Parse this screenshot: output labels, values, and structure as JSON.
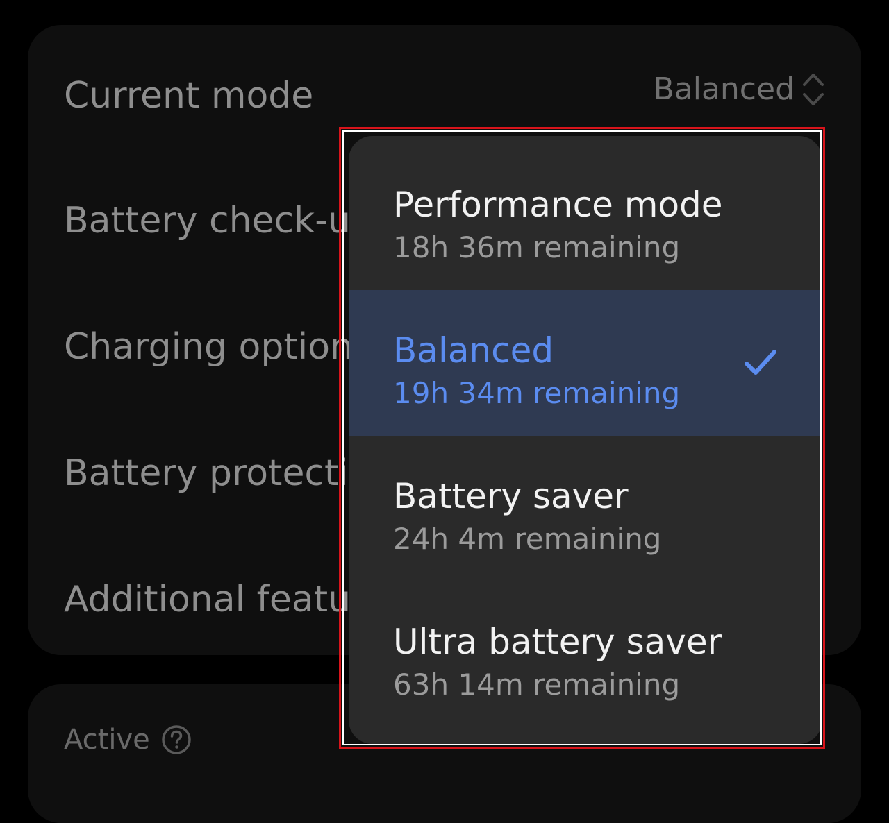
{
  "settings": {
    "current_mode_label": "Current mode",
    "current_mode_value": "Balanced",
    "rows": [
      {
        "label": "Battery check-up"
      },
      {
        "label": "Charging options"
      },
      {
        "label": "Battery protection"
      },
      {
        "label": "Additional features"
      }
    ],
    "active_label": "Active"
  },
  "menu": {
    "items": [
      {
        "title": "Performance mode",
        "subtitle": "18h 36m remaining",
        "selected": false
      },
      {
        "title": "Balanced",
        "subtitle": "19h 34m remaining",
        "selected": true
      },
      {
        "title": "Battery saver",
        "subtitle": "24h 4m remaining",
        "selected": false
      },
      {
        "title": "Ultra battery saver",
        "subtitle": "63h 14m remaining",
        "selected": false
      }
    ]
  },
  "icons": {
    "mode_toggle": "chevron-up-down-icon",
    "active_help": "help-circle-icon",
    "selected_check": "checkmark-icon"
  },
  "colors": {
    "background": "#000000",
    "card": "#0f0f0f",
    "menu": "#2a2a2a",
    "selected_row": "#2f3a52",
    "accent": "#5b8cf0",
    "highlight_border": "#d8141b"
  }
}
